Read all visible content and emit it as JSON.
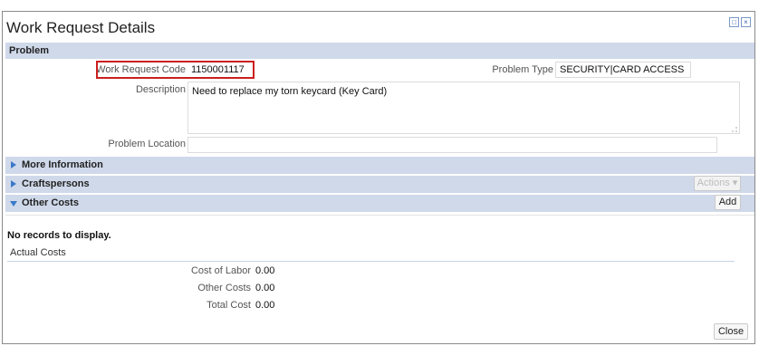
{
  "window": {
    "title": "Work Request Details"
  },
  "problem": {
    "header": "Problem",
    "work_request_code_label": "Work Request Code",
    "work_request_code": "1150001117",
    "problem_type_label": "Problem Type",
    "problem_type": "SECURITY|CARD ACCESS",
    "description_label": "Description",
    "description": "Need to replace my torn keycard (Key Card)",
    "problem_location_label": "Problem Location",
    "problem_location": ""
  },
  "sections": {
    "more_information": "More Information",
    "craftspersons": "Craftspersons",
    "other_costs": "Other Costs"
  },
  "buttons": {
    "actions": "Actions",
    "add": "Add",
    "close": "Close"
  },
  "grid": {
    "empty_message": "No records to display."
  },
  "actual_costs": {
    "header": "Actual Costs",
    "cost_of_labor_label": "Cost of Labor",
    "cost_of_labor": "0.00",
    "other_costs_label": "Other Costs",
    "other_costs": "0.00",
    "total_cost_label": "Total Cost",
    "total_cost": "0.00"
  },
  "colors": {
    "section_bg": "#cfd9ea",
    "highlight": "#cc1f1f",
    "accent": "#3b79c9"
  }
}
